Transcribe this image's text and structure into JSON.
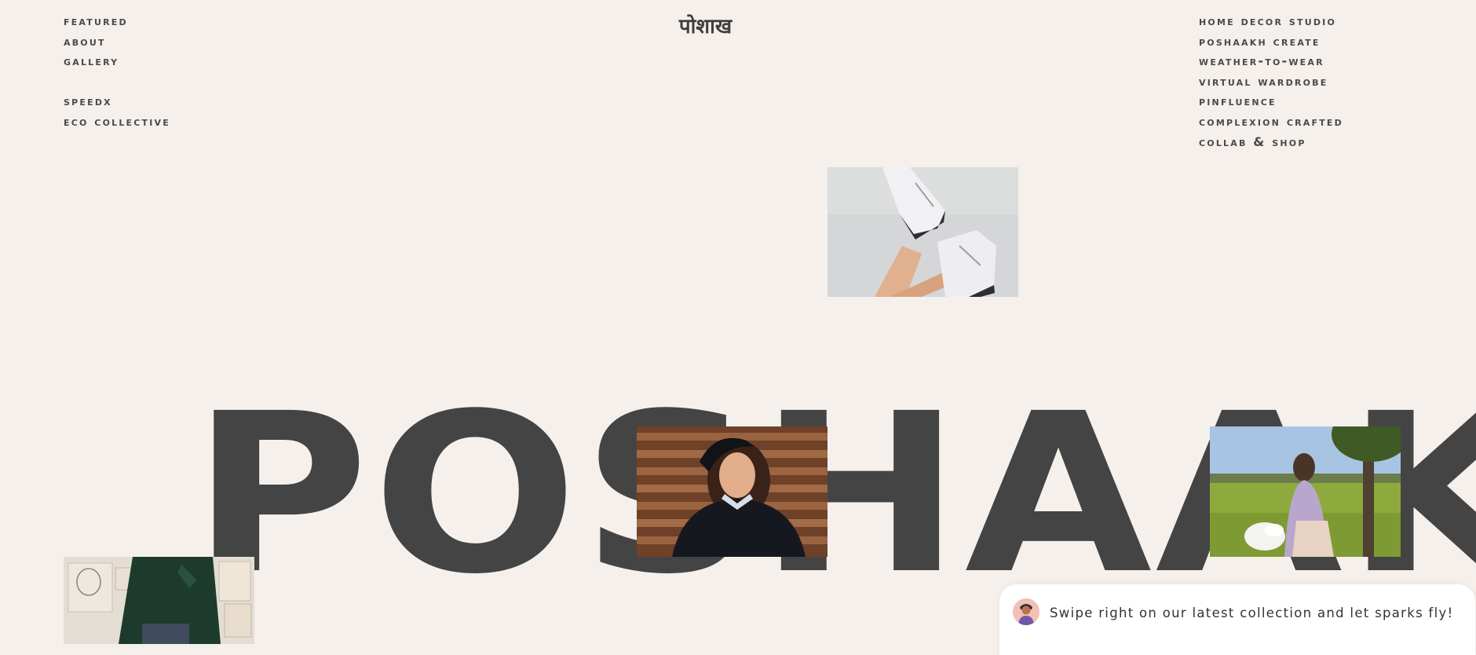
{
  "brand": {
    "logo": "पोशाख"
  },
  "nav_left": {
    "items": [
      {
        "label": "Featured"
      },
      {
        "label": "About"
      },
      {
        "label": "Gallery"
      },
      {
        "label": "SpeedX"
      },
      {
        "label": "Eco Collective"
      }
    ]
  },
  "nav_right": {
    "items": [
      {
        "label": "Home Decor Studio"
      },
      {
        "label": "Poshaakh Create"
      },
      {
        "label": "Weather-to-Wear"
      },
      {
        "label": "Virtual Wardrobe"
      },
      {
        "label": "Pinfluence"
      },
      {
        "label": "Complexion Crafted"
      },
      {
        "label": "Collab & Shop"
      }
    ]
  },
  "hero": {
    "title": "POSHAAK"
  },
  "chat": {
    "message": "Swipe right on our latest collection and let sparks fly!",
    "avatar_icon": "user-avatar-icon"
  },
  "colors": {
    "background": "#f5f0ec",
    "text": "#444444"
  }
}
